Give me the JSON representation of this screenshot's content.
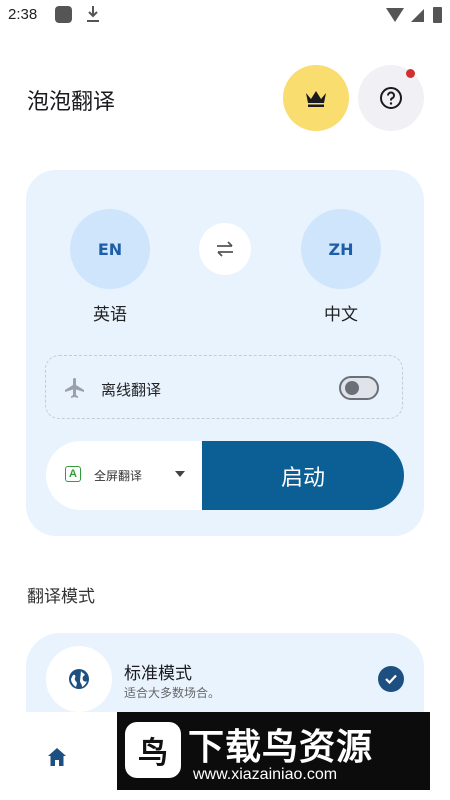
{
  "status_bar": {
    "time": "2:38"
  },
  "header": {
    "title": "泡泡翻译"
  },
  "languages": {
    "source_code": "EN",
    "source_label": "英语",
    "target_code": "ZH",
    "target_label": "中文"
  },
  "offline": {
    "label": "离线翻译",
    "enabled": false
  },
  "action": {
    "mode_label": "全屏翻译",
    "start_label": "启动"
  },
  "section": {
    "title": "翻译模式"
  },
  "modes": [
    {
      "title": "标准模式",
      "desc": "适合大多数场合。",
      "selected": true
    }
  ],
  "watermark": {
    "title": "下载鸟资源",
    "url": "www.xiazainiao.com"
  },
  "colors": {
    "accent": "#0b5f95",
    "card_bg": "#e8f3fe",
    "premium": "#f9dd6e"
  }
}
